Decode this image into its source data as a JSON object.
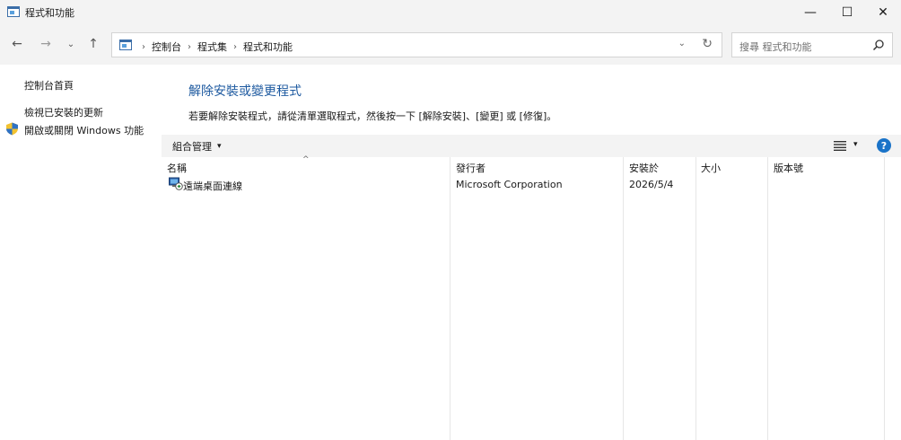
{
  "window": {
    "title": "程式和功能",
    "minimize": "—",
    "maximize": "☐",
    "close": "✕"
  },
  "nav": {
    "back": "←",
    "forward": "→",
    "recent": "⌄",
    "up": "↑",
    "breadcrumbs": [
      "控制台",
      "程式集",
      "程式和功能"
    ],
    "breadcrumb_sep": "›",
    "dropdown": "⌄",
    "refresh": "↻",
    "search_placeholder": "搜尋 程式和功能"
  },
  "sidebar": {
    "items": [
      {
        "label": "控制台首頁"
      },
      {
        "label": "檢視已安裝的更新"
      },
      {
        "label": "開啟或關閉 Windows 功能"
      }
    ]
  },
  "main": {
    "title": "解除安裝或變更程式",
    "description": "若要解除安裝程式，請從清單選取程式，然後按一下 [解除安裝]、[變更] 或 [修復]。"
  },
  "toolbar": {
    "organize_label": "組合管理",
    "caret": "▾",
    "help_label": "?"
  },
  "columns": {
    "name": "名稱",
    "publisher": "發行者",
    "installed_on": "安裝於",
    "size": "大小",
    "version": "版本號",
    "sort_indicator": "^"
  },
  "programs": [
    {
      "name": "遠端桌面連線",
      "publisher": "Microsoft Corporation",
      "installed_on": "2026/5/4",
      "size": "",
      "version": ""
    }
  ],
  "icons": {
    "app": "programs-icon",
    "shield": "uac-shield-icon",
    "search": "search-icon",
    "view": "details-view-icon"
  },
  "colors": {
    "accent": "#1e5aa0",
    "help": "#1a73c8"
  }
}
